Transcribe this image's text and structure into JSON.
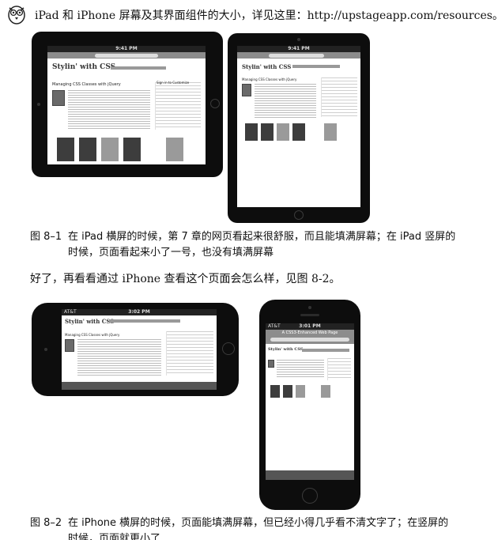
{
  "tip": {
    "icon": "owl-tip-icon",
    "text": "iPad 和 iPhone 屏幕及其界面组件的大小，详见这里：http://upstageapp.com/resources。"
  },
  "figures": [
    {
      "number": "图 8–1",
      "caption_line1": "在 iPad 横屏的时候，第 7 章的网页看起来很舒服，而且能填满屏幕；在 iPad 竖屏的",
      "caption_line2": "时候，页面看起来小了一号，也没有填满屏幕"
    },
    {
      "number": "图 8–2",
      "caption_line1": "在 iPhone 横屏的时候，页面能填满屏幕，但已经小得几乎看不清文字了；在竖屏的",
      "caption_line2": "时候，页面就更小了"
    }
  ],
  "paragraph": "好了，再看看通过 iPhone 查看这个页面会怎么样，见图 8-2。",
  "screens": {
    "site_logo": "Stylin' with CSS",
    "article_title": "Managing CSS Classes with jQuery",
    "sidebar_title": "Sign in to Customize",
    "ipad_time": "9:41 PM",
    "iphone_carrier": "AT&T",
    "iphone_time": "3:02 PM",
    "iphone_portrait_time": "3:01 PM",
    "iphone_portrait_title": "A CSS3-Enhanced Web Page"
  }
}
